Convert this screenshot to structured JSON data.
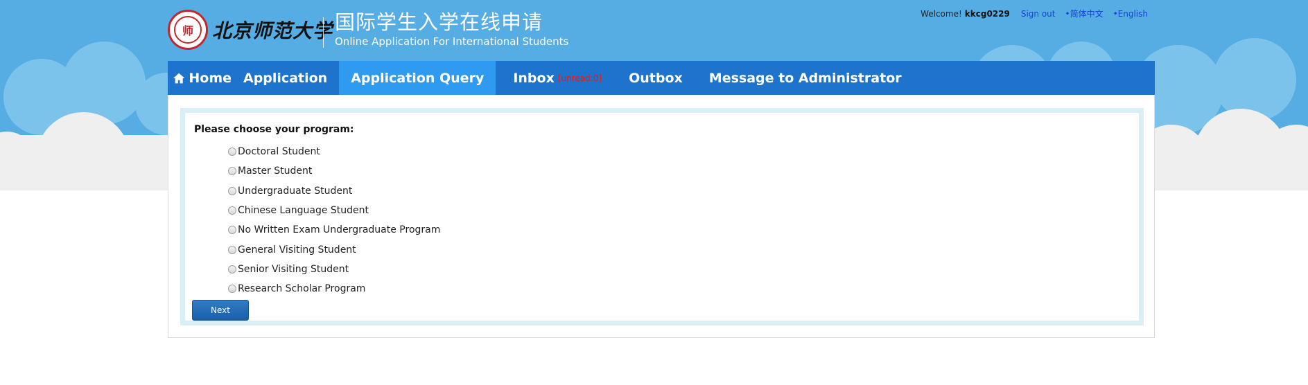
{
  "header": {
    "university_name": "北京师范大学",
    "seal_text": "师",
    "title_cn": "国际学生入学在线申请",
    "title_en": "Online Application For International Students"
  },
  "userbar": {
    "welcome": "Welcome!",
    "username": "kkcg0229",
    "sign_out": "Sign out",
    "lang_cn": "•简体中文",
    "lang_en": "•English"
  },
  "nav": {
    "home": "Home",
    "application": "Application",
    "application_query": "Application Query",
    "inbox": "Inbox",
    "inbox_unread": "[unread:0]",
    "outbox": "Outbox",
    "message_admin": "Message to Administrator",
    "active_tab": "Application Query"
  },
  "form": {
    "prompt": "Please choose your program:",
    "options": [
      "Doctoral Student",
      "Master Student",
      "Undergraduate Student",
      "Chinese Language Student",
      "No Written Exam Undergraduate Program",
      "General Visiting Student",
      "Senior Visiting Student",
      "Research Scholar Program"
    ],
    "next_label": "Next"
  },
  "colors": {
    "sky": "#55ade3",
    "nav_bg": "#1e74cc",
    "nav_active": "#2e9af0",
    "frame_border": "#d9eef5",
    "unread": "#e21b1b",
    "link": "#1a3fd8"
  }
}
